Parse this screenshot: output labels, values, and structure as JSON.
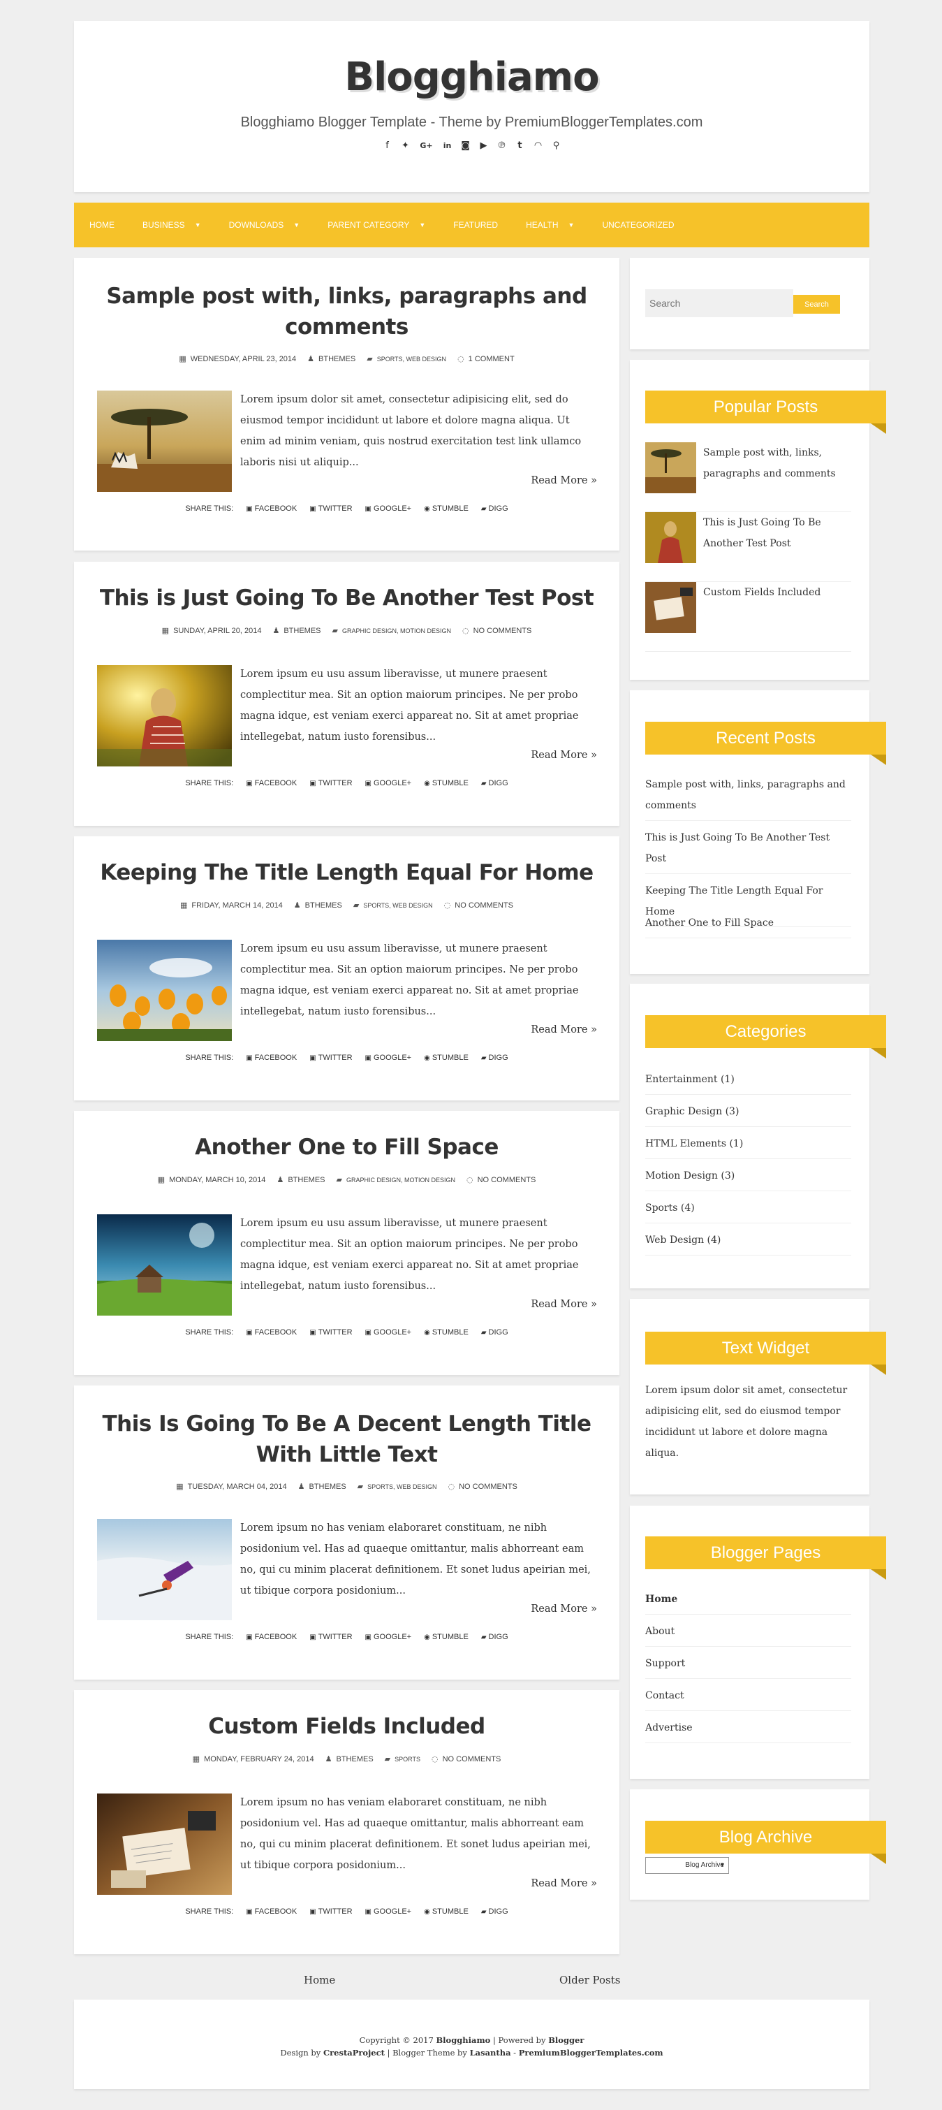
{
  "header": {
    "site_title": "Blogghiamo",
    "site_description": "Blogghiamo Blogger Template - Theme by PremiumBloggerTemplates.com",
    "social_icons": [
      "facebook-icon",
      "twitter-icon",
      "google-plus-icon",
      "linkedin-icon",
      "instagram-icon",
      "youtube-icon",
      "pinterest-icon",
      "tumblr-icon",
      "rss-icon",
      "search-icon"
    ]
  },
  "nav": {
    "items": [
      {
        "label": "Home"
      },
      {
        "label": "Business",
        "dropdown": true
      },
      {
        "label": "Downloads",
        "dropdown": true
      },
      {
        "label": "Parent Category",
        "dropdown": true
      },
      {
        "label": "Featured"
      },
      {
        "label": "Health",
        "dropdown": true
      },
      {
        "label": "Uncategorized"
      }
    ]
  },
  "posts": [
    {
      "title": "Sample post with, links, paragraphs and comments",
      "date": "Wednesday, April 23, 2014",
      "author": "BThemes",
      "categories": "Sports, Web Design",
      "comments": "1 Comment",
      "excerpt": "Lorem ipsum dolor sit amet, consectetur adipisicing elit, sed do eiusmod tempor incididunt ut labore et dolore magna aliqua. Ut enim ad minim veniam, quis nostrud exercitation test link ullamco laboris nisi ut aliquip...",
      "read_more": "Read More »"
    },
    {
      "title": "This is Just Going To Be Another Test Post",
      "date": "Sunday, April 20, 2014",
      "author": "BThemes",
      "categories": "Graphic Design, Motion Design",
      "comments": "No Comments",
      "excerpt": "Lorem ipsum eu usu assum liberavisse, ut munere praesent complectitur mea. Sit an option maiorum principes. Ne per probo magna idque, est veniam exerci appareat no. Sit at amet propriae intellegebat, natum iusto forensibus...",
      "read_more": "Read More »"
    },
    {
      "title": "Keeping The Title Length Equal For Home",
      "date": "Friday, March 14, 2014",
      "author": "BThemes",
      "categories": "Sports, Web Design",
      "comments": "No Comments",
      "excerpt": "Lorem ipsum eu usu assum liberavisse, ut munere praesent complectitur mea. Sit an option maiorum principes. Ne per probo magna idque, est veniam exerci appareat no. Sit at amet propriae intellegebat, natum iusto forensibus...",
      "read_more": "Read More »"
    },
    {
      "title": "Another One to Fill Space",
      "date": "Monday, March 10, 2014",
      "author": "BThemes",
      "categories": "Graphic Design, Motion Design",
      "comments": "No Comments",
      "excerpt": "Lorem ipsum eu usu assum liberavisse, ut munere praesent complectitur mea. Sit an option maiorum principes. Ne per probo magna idque, est veniam exerci appareat no. Sit at amet propriae intellegebat, natum iusto forensibus...",
      "read_more": "Read More »"
    },
    {
      "title": "This Is Going To Be A Decent Length Title With Little Text",
      "date": "Tuesday, March 04, 2014",
      "author": "BThemes",
      "categories": "Sports, Web Design",
      "comments": "No Comments",
      "excerpt": "Lorem ipsum no has veniam elaboraret constituam, ne nibh posidonium vel. Has ad quaeque omittantur, malis abhorreant eam no, qui cu minim placerat definitionem. Et sonet ludus apeirian mei, ut tibique corpora posidonium...",
      "read_more": "Read More »"
    },
    {
      "title": "Custom Fields Included",
      "date": "Monday, February 24, 2014",
      "author": "BThemes",
      "categories": "Sports",
      "comments": "No Comments",
      "excerpt": "Lorem ipsum no has veniam elaboraret constituam, ne nibh posidonium vel. Has ad quaeque omittantur, malis abhorreant eam no, qui cu minim placerat definitionem. Et sonet ludus apeirian mei, ut tibique corpora posidonium...",
      "read_more": "Read More »"
    }
  ],
  "share": {
    "label": "Share This:",
    "facebook": "Facebook",
    "twitter": "Twitter",
    "google": "Google+",
    "stumble": "Stumble",
    "digg": "Digg"
  },
  "sidebar": {
    "search": {
      "placeholder": "Search",
      "button": "Search"
    },
    "popular": {
      "title": "Popular Posts",
      "items": [
        {
          "label": "Sample post with, links, paragraphs and comments"
        },
        {
          "label": "This is Just Going To Be Another Test Post"
        },
        {
          "label": "Custom Fields Included"
        }
      ]
    },
    "recent": {
      "title": "Recent Posts",
      "items": [
        {
          "label": "Sample post with, links, paragraphs and comments"
        },
        {
          "label": "This is Just Going To Be Another Test Post"
        },
        {
          "label": "Keeping The Title Length Equal For Home"
        },
        {
          "label": "Another One to Fill Space"
        }
      ]
    },
    "categories": {
      "title": "Categories",
      "items": [
        {
          "label": "Entertainment (1)"
        },
        {
          "label": "Graphic Design (3)"
        },
        {
          "label": "HTML Elements (1)"
        },
        {
          "label": "Motion Design (3)"
        },
        {
          "label": "Sports (4)"
        },
        {
          "label": "Web Design (4)"
        }
      ]
    },
    "text_widget": {
      "title": "Text Widget",
      "body": "Lorem ipsum dolor sit amet, consectetur adipisicing elit, sed do eiusmod tempor incididunt ut labore et dolore magna aliqua."
    },
    "pages": {
      "title": "Blogger Pages",
      "items": [
        {
          "label": "Home"
        },
        {
          "label": "About"
        },
        {
          "label": "Support"
        },
        {
          "label": "Contact"
        },
        {
          "label": "Advertise"
        }
      ]
    },
    "archive": {
      "title": "Blog Archive",
      "select_value": "Blog Archive"
    }
  },
  "pager": {
    "home": "Home",
    "older": "Older Posts"
  },
  "footer": {
    "copyright": "Copyright © 2017",
    "site": "Blogghiamo",
    "powered": " | Powered by ",
    "blogger": "Blogger",
    "design_by": "Design by ",
    "cresta": "CrestaProject",
    "theme_by": " | Blogger Theme by ",
    "lasantha": "Lasantha",
    "sep": " - ",
    "pbt": "PremiumBloggerTemplates.com"
  },
  "colors": {
    "accent": "#f6c229",
    "accent_dark": "#c99a10",
    "background": "#efefef",
    "text": "#333333"
  }
}
